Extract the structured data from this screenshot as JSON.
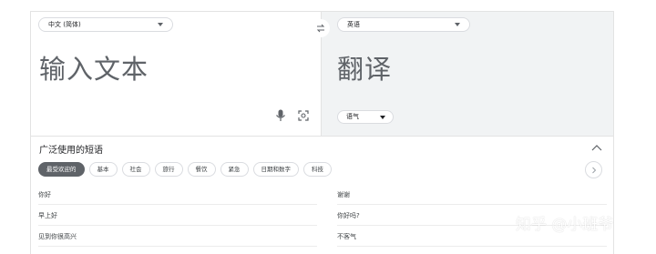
{
  "source": {
    "language": "中文 (简体)",
    "text": "输入文本"
  },
  "target": {
    "language": "英语",
    "text": "翻译",
    "tone": "语气"
  },
  "phrases": {
    "title": "广泛使用的短语",
    "categories": [
      "最受欢迎的",
      "基本",
      "社会",
      "旅行",
      "餐饮",
      "紧急",
      "日期和数字",
      "科技"
    ],
    "active_category": "最受欢迎的",
    "rows": [
      {
        "left": "你好",
        "right": "谢谢"
      },
      {
        "left": "早上好",
        "right": "你好吗?"
      },
      {
        "left": "见到你很高兴",
        "right": "不客气"
      }
    ]
  },
  "watermark": "知乎 @小班爷",
  "colors": {
    "target_pane_bg": "#f1f3f4",
    "active_chip_bg": "#5f6368",
    "border": "#dadce0"
  }
}
